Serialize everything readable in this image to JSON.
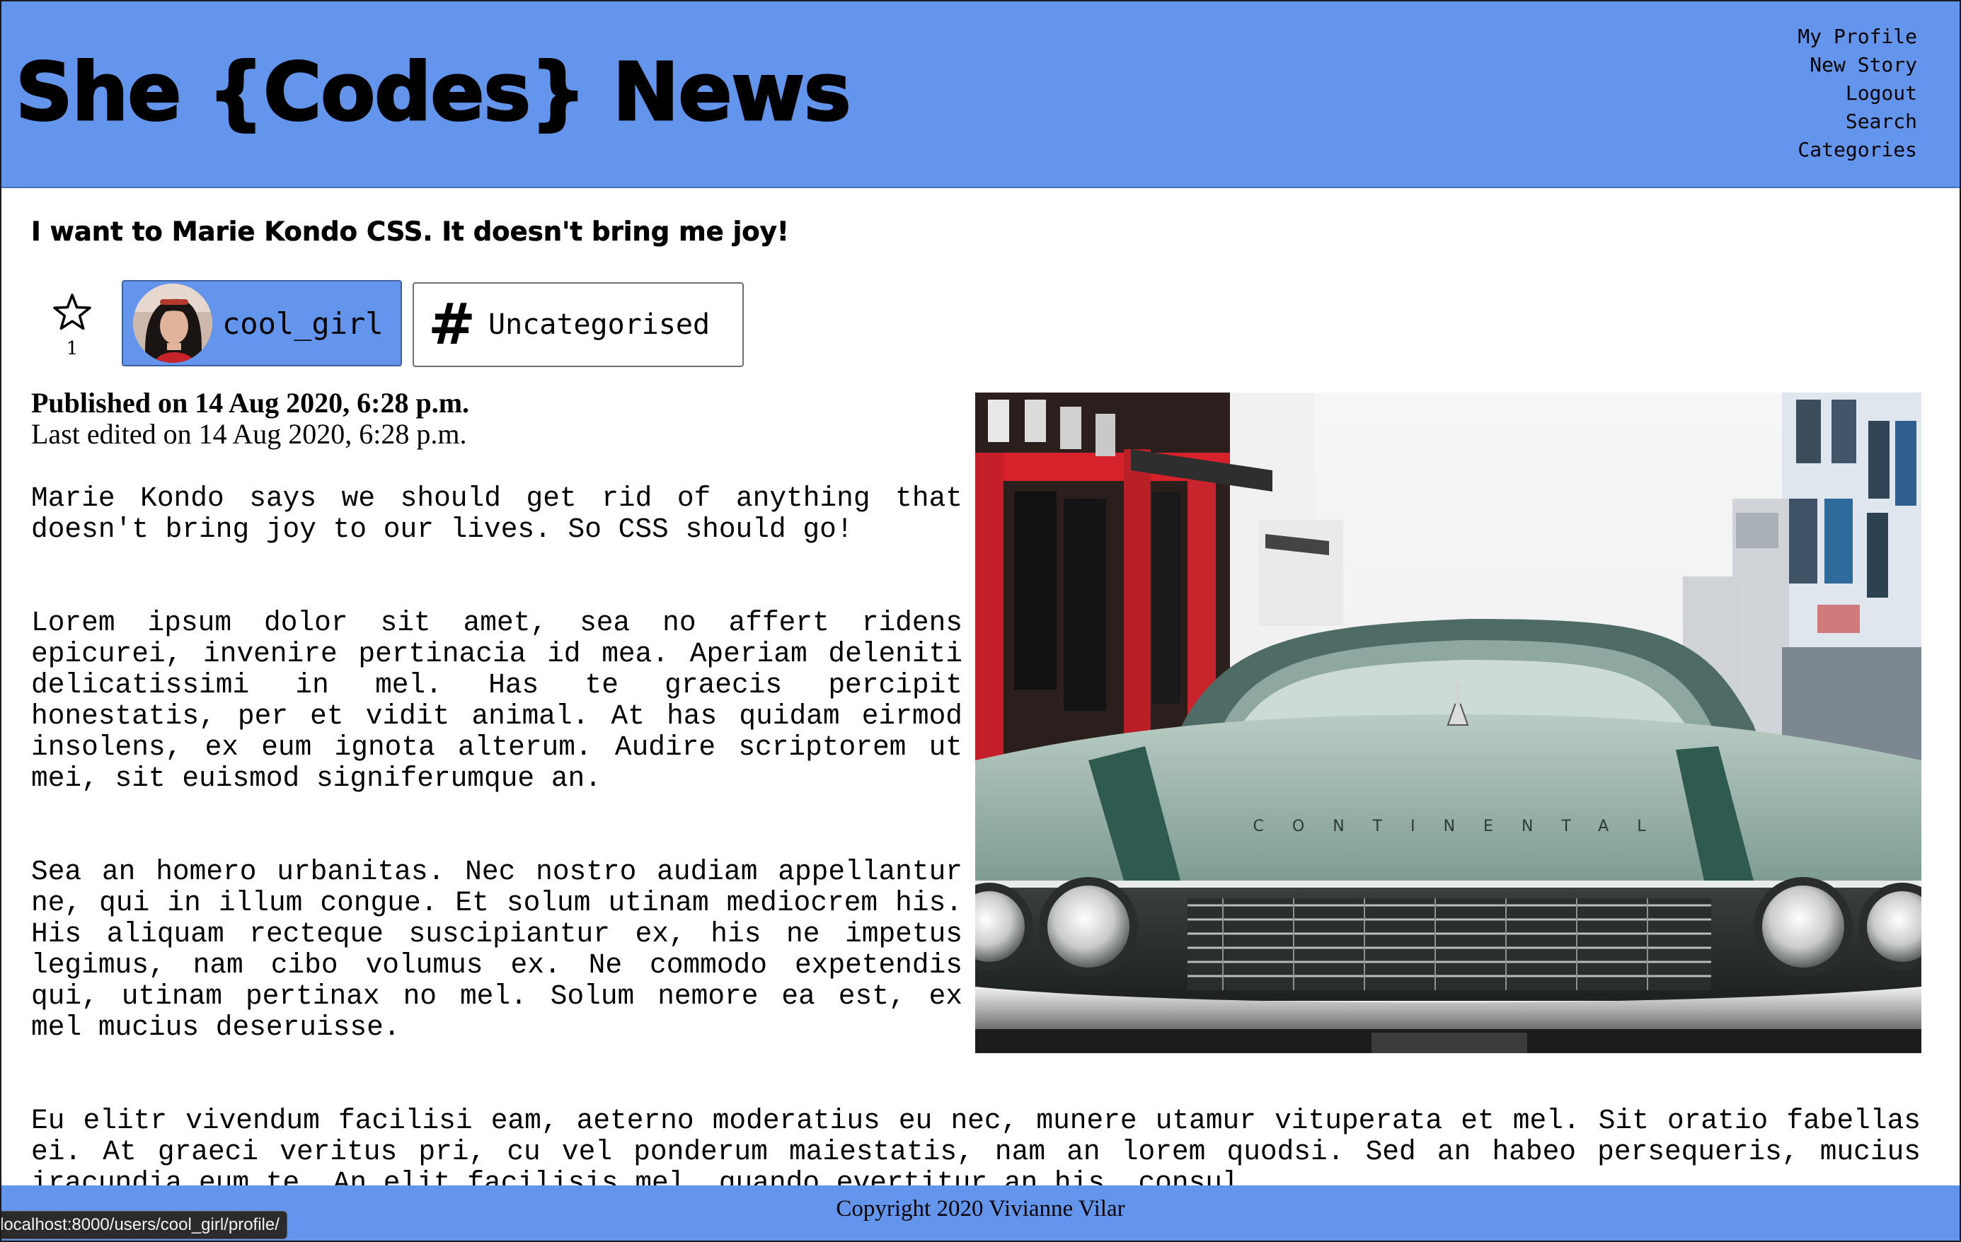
{
  "header": {
    "site_title": "She {Codes} News",
    "nav": [
      "My Profile",
      "New Story",
      "Logout",
      "Search",
      "Categories"
    ]
  },
  "story": {
    "title": "I want to Marie Kondo CSS. It doesn't bring me joy!",
    "favourite_count": "1",
    "author": "cool_girl",
    "category": "Uncategorised",
    "published": "Published on 14 Aug 2020, 6:28 p.m.",
    "last_edited": "Last edited on 14 Aug 2020, 6:28 p.m.",
    "image_car_badge": "CONTINENTAL",
    "paragraphs": [
      "Marie Kondo says we should get rid of anything that doesn't bring joy to our lives. So CSS should go!",
      "Lorem ipsum dolor sit amet, sea no affert ridens epicurei, invenire pertinacia id mea. Aperiam deleniti delicatissimi in mel. Has te graecis percipit honestatis, per et vidit animal. At has quidam eirmod insolens, ex eum ignota alterum. Audire scriptorem ut mei, sit euismod signiferumque an.",
      "Sea an homero urbanitas. Nec nostro audiam appellantur ne, qui in illum congue. Et solum utinam mediocrem his. His aliquam recteque suscipiantur ex, his ne impetus legimus, nam cibo volumus ex. Ne commodo expetendis qui, utinam pertinax no mel. Solum nemore ea est, ex mel mucius deseruisse.",
      "Eu elitr vivendum facilisi eam, aeterno moderatius eu nec, munere utamur vituperata et mel. Sit oratio fabellas ei. At graeci veritus pri, cu vel ponderum maiestatis, nam an lorem quodsi. Sed an habeo persequeris, mucius iracundia eum te. An elit facilisis mel, quando evertitur an his, consul"
    ]
  },
  "footer": {
    "copyright": "Copyright 2020 Vivianne Vilar"
  },
  "status_bar": {
    "url": "localhost:8000/users/cool_girl/profile/"
  },
  "colors": {
    "header_bg": "#6495ed",
    "footer_bg": "#6495ed",
    "author_chip_bg": "#6495ed"
  },
  "icons": [
    "star-icon",
    "hash-icon",
    "avatar-photo"
  ]
}
